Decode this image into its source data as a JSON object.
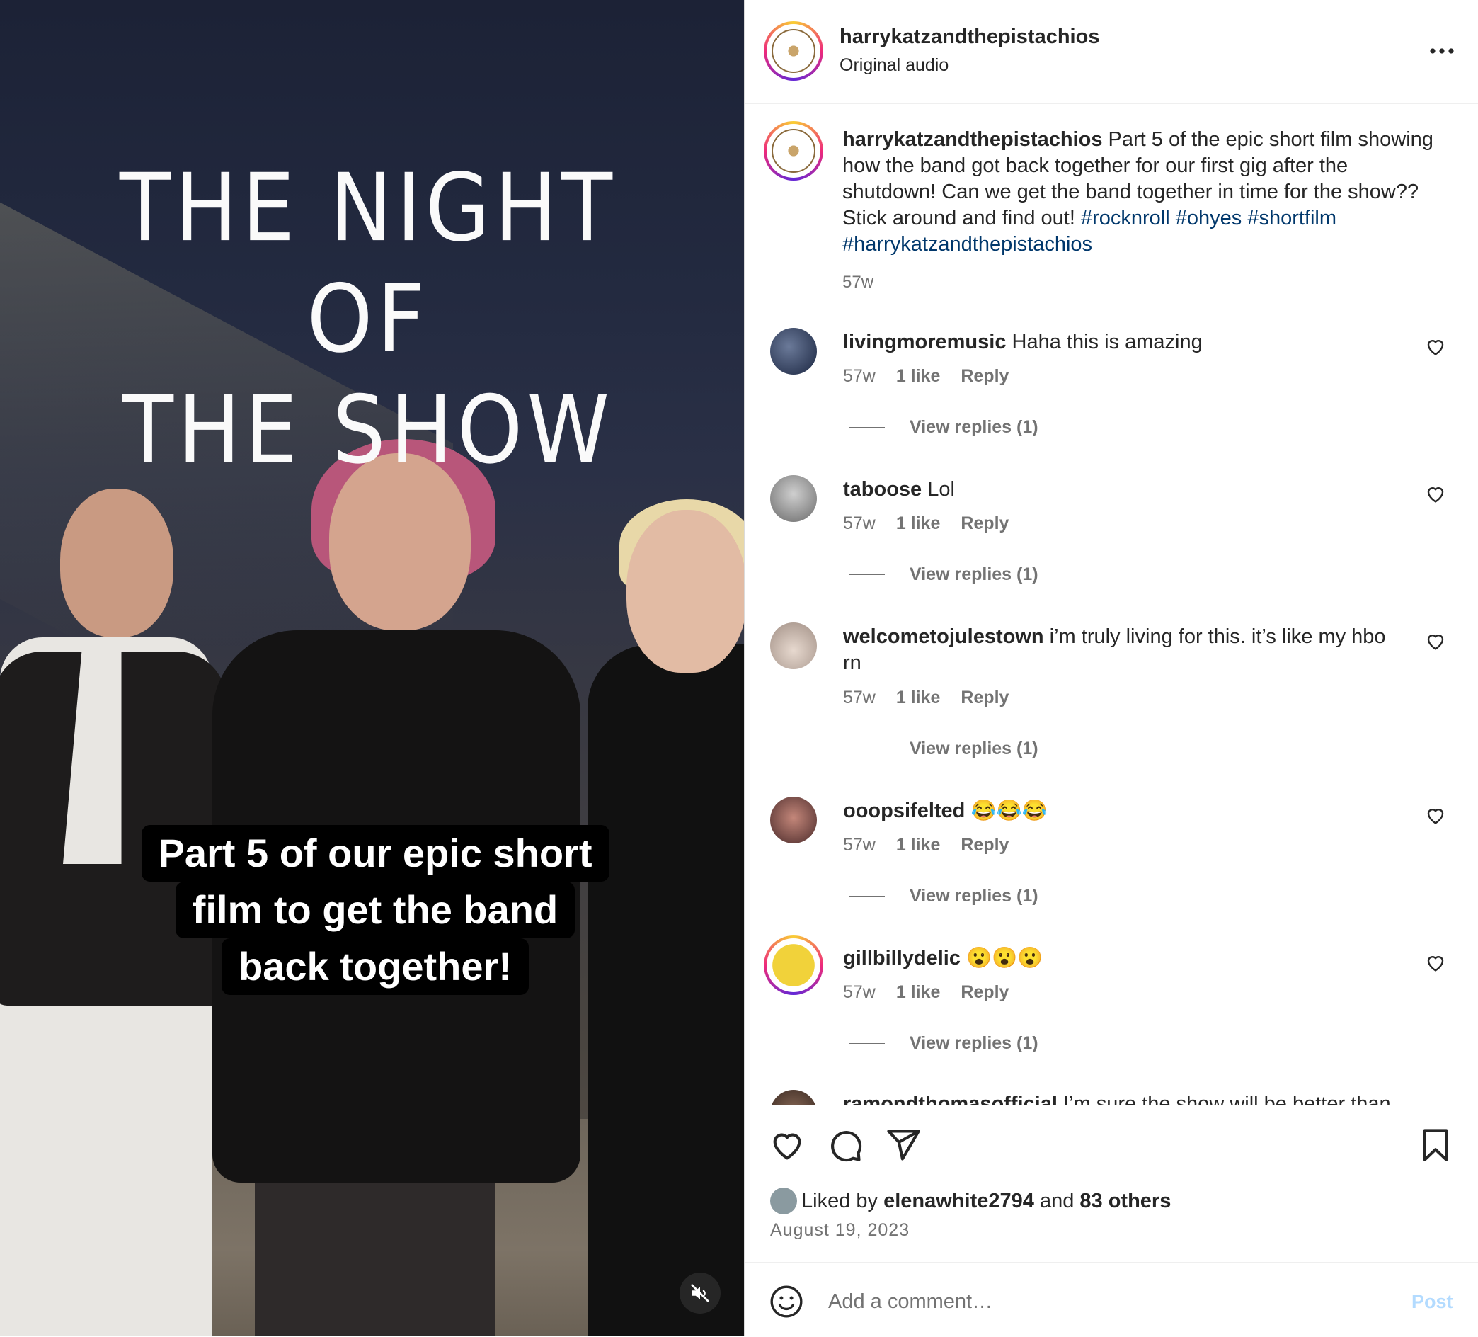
{
  "video": {
    "title_line1": "THE NIGHT OF",
    "title_line2": "THE SHOW",
    "caption_lines": [
      "Part 5 of our epic short",
      "film to get the band",
      "back together!"
    ],
    "mute_icon": "volume-muted-icon"
  },
  "header": {
    "username": "harrykatzandthepistachios",
    "subtitle": "Original audio",
    "more_icon": "more-horizontal-icon"
  },
  "post": {
    "username": "harrykatzandthepistachios",
    "text": "Part 5 of the epic short film showing how the band got back together for our first gig after the shutdown! Can we get the band together in time for the show?? Stick around and find out!",
    "hashtags": [
      "#rocknroll",
      "#ohyes",
      "#shortfilm",
      "#harrykatzandthepistachios"
    ],
    "time": "57w"
  },
  "comments": [
    {
      "username": "livingmoremusic",
      "text": "Haha this is amazing",
      "time": "57w",
      "likes": "1 like",
      "reply": "Reply",
      "view_replies": "View replies (1)"
    },
    {
      "username": "taboose",
      "text": "Lol",
      "time": "57w",
      "likes": "1 like",
      "reply": "Reply",
      "view_replies": "View replies (1)"
    },
    {
      "username": "welcometojulestown",
      "text": "i’m truly living for this. it’s like my hbo rn",
      "time": "57w",
      "likes": "1 like",
      "reply": "Reply",
      "view_replies": "View replies (1)"
    },
    {
      "username": "ooopsifelted",
      "text": "😂😂😂",
      "time": "57w",
      "likes": "1 like",
      "reply": "Reply",
      "view_replies": "View replies (1)"
    },
    {
      "username": "gillbillydelic",
      "text": "😮😮😮",
      "time": "57w",
      "likes": "1 like",
      "reply": "Reply",
      "view_replies": "View replies (1)"
    },
    {
      "username": "ramondthomasofficial",
      "text": "I’m sure the show will be better than"
    }
  ],
  "actions": {
    "liked_by_prefix": "Liked by",
    "liked_by_user": "elenawhite2794",
    "liked_by_and": "and",
    "liked_by_others": "83 others",
    "date": "August 19, 2023"
  },
  "add_comment": {
    "placeholder": "Add a comment…",
    "post_label": "Post"
  },
  "colors": {
    "link": "#00376b",
    "secondary_text": "#737373",
    "post_button_disabled": "#b3dbff"
  }
}
